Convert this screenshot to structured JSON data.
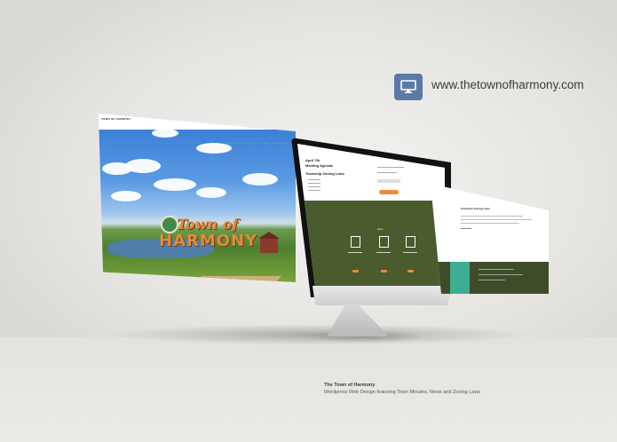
{
  "brand": {
    "icon": "monitor-icon",
    "url": "www.thetownofharmony.com",
    "accent": "#5b7aa4"
  },
  "left_page": {
    "header_title": "TOWN OF HARMONY",
    "logo_script": "Town of",
    "logo_main": "HARMONY"
  },
  "monitor_page": {
    "heading_1": "April 7th",
    "heading_2": "Meeting Agenda",
    "heading_3": "Township Zoning Laws",
    "section_title": "Files",
    "green": "#4a5b2e",
    "accent": "#f08b3e"
  },
  "right_page": {
    "title": "Township Zoning Laws",
    "footer_color": "#3f4c2a",
    "teal": "#3cae93"
  },
  "caption": {
    "title": "The Town of Harmony",
    "subtitle": "Wordpress Web Design featuring Town Minutes, News and Zoning Laws"
  }
}
